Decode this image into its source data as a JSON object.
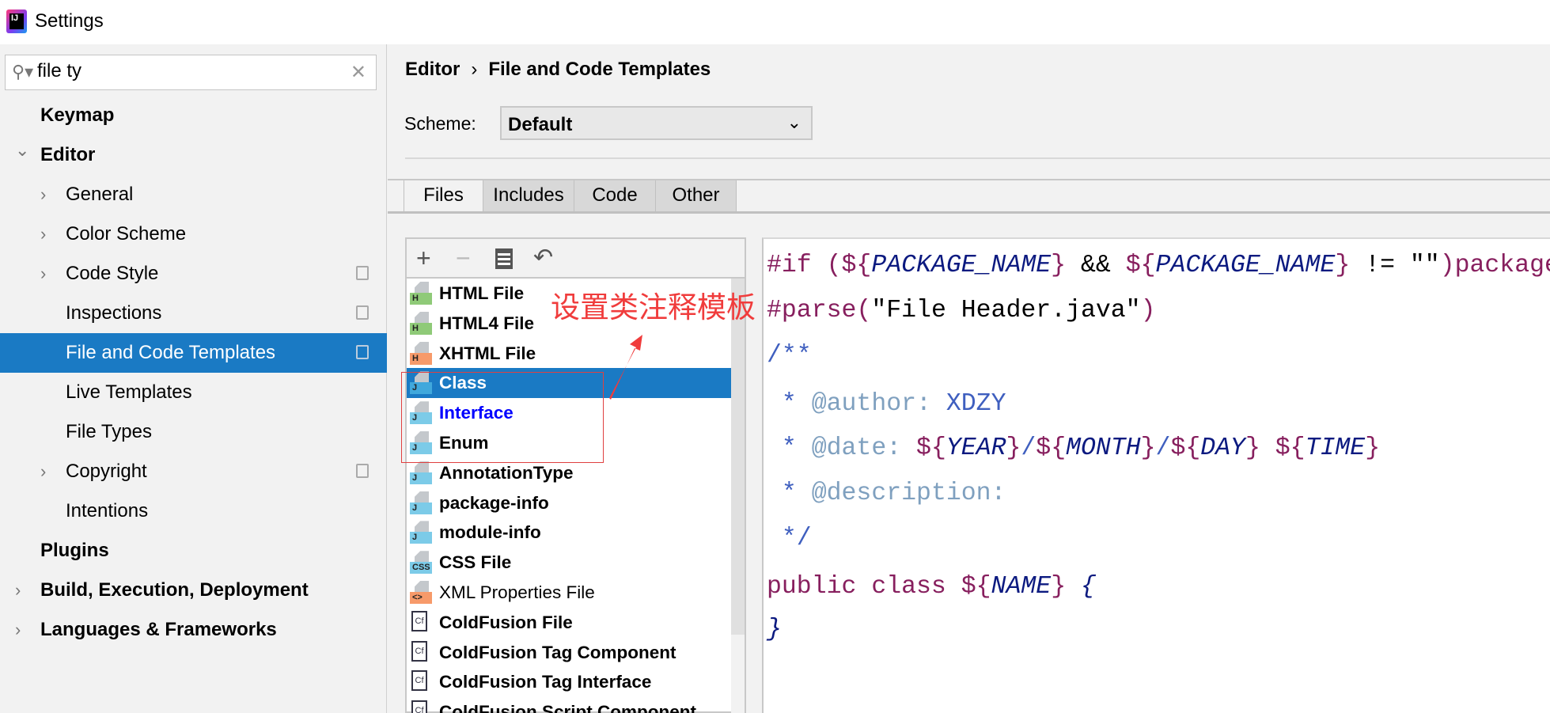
{
  "window": {
    "title": "Settings",
    "icon": "intellij-idea-icon"
  },
  "search": {
    "value": "file ty",
    "icon": "search-icon",
    "clear_icon": "close-icon"
  },
  "sidebar": {
    "items": [
      {
        "label": "Keymap",
        "level": 0,
        "bold": true,
        "arrow": ""
      },
      {
        "label": "Editor",
        "level": 0,
        "bold": true,
        "arrow": "expanded"
      },
      {
        "label": "General",
        "level": 1,
        "arrow": "collapsed"
      },
      {
        "label": "Color Scheme",
        "level": 1,
        "arrow": "collapsed"
      },
      {
        "label": "Code Style",
        "level": 1,
        "arrow": "collapsed",
        "copy_icon": true
      },
      {
        "label": "Inspections",
        "level": 1,
        "copy_icon": true
      },
      {
        "label": "File and Code Templates",
        "level": 1,
        "copy_icon": true,
        "selected": true
      },
      {
        "label": "Live Templates",
        "level": 1
      },
      {
        "label": "File Types",
        "level": 1
      },
      {
        "label": "Copyright",
        "level": 1,
        "arrow": "collapsed",
        "copy_icon": true
      },
      {
        "label": "Intentions",
        "level": 1
      },
      {
        "label": "Plugins",
        "level": 0,
        "bold": true
      },
      {
        "label": "Build, Execution, Deployment",
        "level": 0,
        "bold": true,
        "arrow": "collapsed"
      },
      {
        "label": "Languages & Frameworks",
        "level": 0,
        "bold": true,
        "arrow": "collapsed"
      }
    ]
  },
  "breadcrumb": {
    "parent": "Editor",
    "separator": "›",
    "current": "File and Code Templates"
  },
  "scheme": {
    "label": "Scheme:",
    "value": "Default"
  },
  "tabs": [
    {
      "label": "Files",
      "active": true
    },
    {
      "label": "Includes"
    },
    {
      "label": "Code"
    },
    {
      "label": "Other"
    }
  ],
  "toolbar": {
    "add": "+",
    "remove": "−",
    "copy_icon": "copy-icon",
    "reset_icon": "undo-icon"
  },
  "templates": [
    {
      "label": "HTML File",
      "badge": "H",
      "color": "#8fca78"
    },
    {
      "label": "HTML4 File",
      "badge": "H",
      "color": "#8fca78"
    },
    {
      "label": "XHTML File",
      "badge": "H",
      "color": "#f79a6a"
    },
    {
      "label": "Class",
      "badge": "J",
      "color": "#40a8dc",
      "selected": true
    },
    {
      "label": "Interface",
      "badge": "J",
      "color": "#7ccbe8",
      "link": true
    },
    {
      "label": "Enum",
      "badge": "J",
      "color": "#7ccbe8"
    },
    {
      "label": "AnnotationType",
      "badge": "J",
      "color": "#7ccbe8"
    },
    {
      "label": "package-info",
      "badge": "J",
      "color": "#7ccbe8"
    },
    {
      "label": "module-info",
      "badge": "J",
      "color": "#7ccbe8"
    },
    {
      "label": "CSS File",
      "badge": "CSS",
      "color": "#7ccbe8"
    },
    {
      "label": "XML Properties File",
      "badge": "<>",
      "color": "#f79a6a",
      "plain": true
    },
    {
      "label": "ColdFusion File",
      "badge": "Cf",
      "cf": true
    },
    {
      "label": "ColdFusion Tag Component",
      "badge": "Cf",
      "cf": true
    },
    {
      "label": "ColdFusion Tag Interface",
      "badge": "Cf",
      "cf": true
    },
    {
      "label": "ColdFusion Script Component",
      "badge": "Cf",
      "cf": true
    }
  ],
  "editor": {
    "lines": [
      [
        [
          "k",
          "#if ("
        ],
        [
          "k",
          "${"
        ],
        [
          "v",
          "PACKAGE_NAME"
        ],
        [
          "k",
          "}"
        ],
        [
          "t",
          " && "
        ],
        [
          "k",
          "${"
        ],
        [
          "v",
          "PACKAGE_NAME"
        ],
        [
          "k",
          "}"
        ],
        [
          "t",
          " != \"\""
        ],
        [
          "k",
          ")package"
        ]
      ],
      [
        [
          "k",
          "#parse"
        ],
        [
          "k",
          "("
        ],
        [
          "t",
          "\"File Header.java\""
        ],
        [
          "k",
          ")"
        ]
      ],
      [
        [
          "c",
          "/**"
        ]
      ],
      [
        [
          "c",
          " * "
        ],
        [
          "g",
          "@author:"
        ],
        [
          "c",
          " XDZY"
        ]
      ],
      [
        [
          "c",
          " * "
        ],
        [
          "g",
          "@date:"
        ],
        [
          "k",
          " ${"
        ],
        [
          "v",
          "YEAR"
        ],
        [
          "k",
          "}"
        ],
        [
          "c",
          "/"
        ],
        [
          "k",
          "${"
        ],
        [
          "v",
          "MONTH"
        ],
        [
          "k",
          "}"
        ],
        [
          "c",
          "/"
        ],
        [
          "k",
          "${"
        ],
        [
          "v",
          "DAY"
        ],
        [
          "k",
          "}"
        ],
        [
          "k",
          " ${"
        ],
        [
          "v",
          "TIME"
        ],
        [
          "k",
          "}"
        ]
      ],
      [
        [
          "c",
          " * "
        ],
        [
          "g",
          "@description:"
        ]
      ],
      [
        [
          "c",
          " */"
        ]
      ],
      [
        [
          "k",
          "public class "
        ],
        [
          "k",
          "${"
        ],
        [
          "v",
          "NAME"
        ],
        [
          "k",
          "}"
        ],
        [
          "v",
          " {"
        ]
      ],
      [
        [
          "v",
          "}"
        ]
      ]
    ]
  },
  "annotation": {
    "text": "设置类注释模板",
    "color": "#f03c3c"
  }
}
